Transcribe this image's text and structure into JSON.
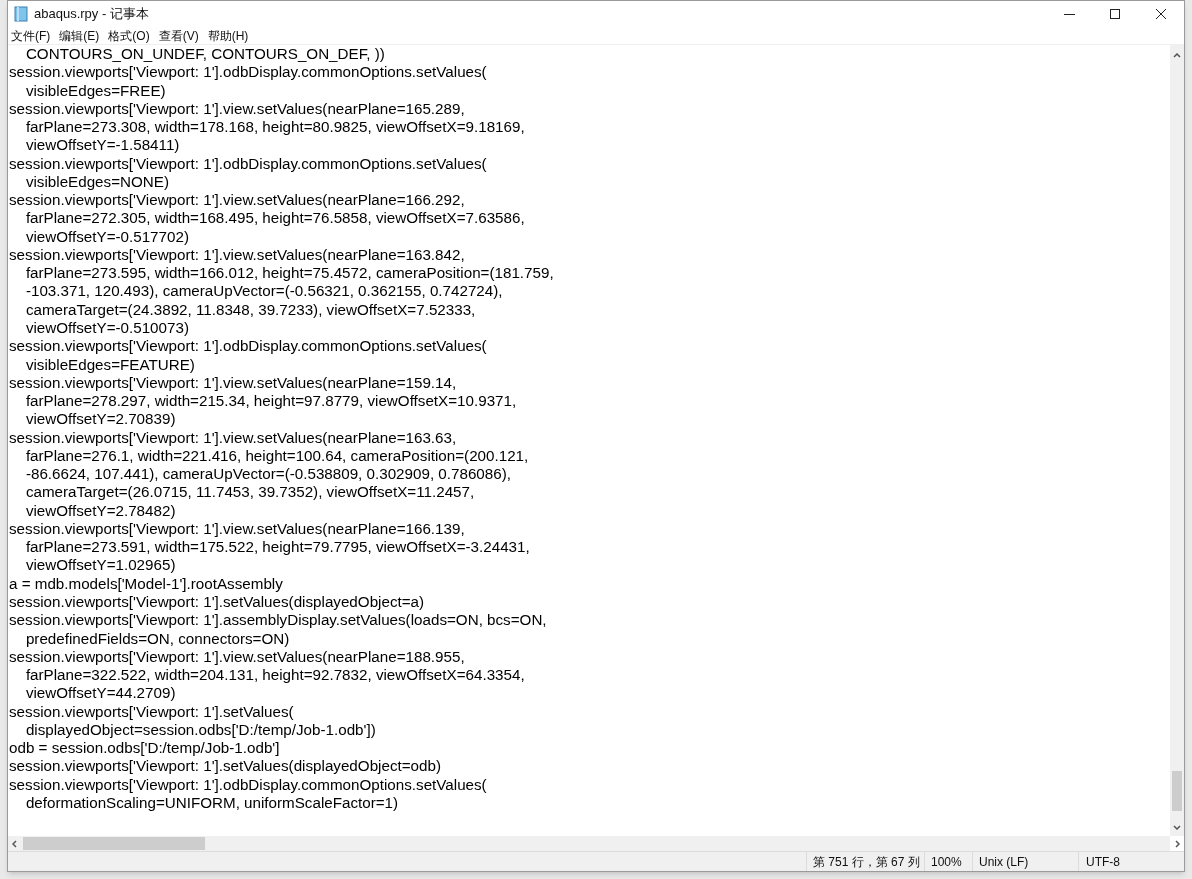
{
  "window": {
    "title": "abaqus.rpy - 记事本"
  },
  "menu": [
    "文件(F)",
    "编辑(E)",
    "格式(O)",
    "查看(V)",
    "帮助(H)"
  ],
  "lines": [
    "    CONTOURS_ON_UNDEF, CONTOURS_ON_DEF, ))",
    "session.viewports['Viewport: 1'].odbDisplay.commonOptions.setValues(",
    "    visibleEdges=FREE)",
    "session.viewports['Viewport: 1'].view.setValues(nearPlane=165.289,",
    "    farPlane=273.308, width=178.168, height=80.9825, viewOffsetX=9.18169,",
    "    viewOffsetY=-1.58411)",
    "session.viewports['Viewport: 1'].odbDisplay.commonOptions.setValues(",
    "    visibleEdges=NONE)",
    "session.viewports['Viewport: 1'].view.setValues(nearPlane=166.292,",
    "    farPlane=272.305, width=168.495, height=76.5858, viewOffsetX=7.63586,",
    "    viewOffsetY=-0.517702)",
    "session.viewports['Viewport: 1'].view.setValues(nearPlane=163.842,",
    "    farPlane=273.595, width=166.012, height=75.4572, cameraPosition=(181.759,",
    "    -103.371, 120.493), cameraUpVector=(-0.56321, 0.362155, 0.742724),",
    "    cameraTarget=(24.3892, 11.8348, 39.7233), viewOffsetX=7.52333,",
    "    viewOffsetY=-0.510073)",
    "session.viewports['Viewport: 1'].odbDisplay.commonOptions.setValues(",
    "    visibleEdges=FEATURE)",
    "session.viewports['Viewport: 1'].view.setValues(nearPlane=159.14,",
    "    farPlane=278.297, width=215.34, height=97.8779, viewOffsetX=10.9371,",
    "    viewOffsetY=2.70839)",
    "session.viewports['Viewport: 1'].view.setValues(nearPlane=163.63,",
    "    farPlane=276.1, width=221.416, height=100.64, cameraPosition=(200.121,",
    "    -86.6624, 107.441), cameraUpVector=(-0.538809, 0.302909, 0.786086),",
    "    cameraTarget=(26.0715, 11.7453, 39.7352), viewOffsetX=11.2457,",
    "    viewOffsetY=2.78482)",
    "session.viewports['Viewport: 1'].view.setValues(nearPlane=166.139,",
    "    farPlane=273.591, width=175.522, height=79.7795, viewOffsetX=-3.24431,",
    "    viewOffsetY=1.02965)",
    "a = mdb.models['Model-1'].rootAssembly",
    "session.viewports['Viewport: 1'].setValues(displayedObject=a)",
    "session.viewports['Viewport: 1'].assemblyDisplay.setValues(loads=ON, bcs=ON,",
    "    predefinedFields=ON, connectors=ON)",
    "session.viewports['Viewport: 1'].view.setValues(nearPlane=188.955,",
    "    farPlane=322.522, width=204.131, height=92.7832, viewOffsetX=64.3354,",
    "    viewOffsetY=44.2709)",
    "session.viewports['Viewport: 1'].setValues(",
    "    displayedObject=session.odbs['D:/temp/Job-1.odb'])",
    "odb = session.odbs['D:/temp/Job-1.odb']",
    "session.viewports['Viewport: 1'].setValues(displayedObject=odb)",
    "session.viewports['Viewport: 1'].odbDisplay.commonOptions.setValues(",
    "    deformationScaling=UNIFORM, uniformScaleFactor=1)"
  ],
  "status_bar": {
    "position": "第 751 行，第 67 列",
    "zoom": "100%",
    "line_ending": "Unix (LF)",
    "encoding": "UTF-8"
  }
}
